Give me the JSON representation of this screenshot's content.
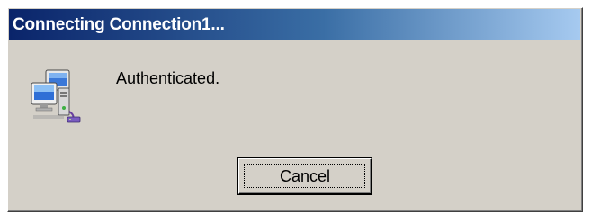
{
  "window": {
    "title": "Connecting Connection1..."
  },
  "status": {
    "message": "Authenticated.",
    "icon": "network-connection-icon"
  },
  "buttons": {
    "cancel_label": "Cancel"
  },
  "colors": {
    "dialog_bg": "#d4d0c8",
    "titlebar_start": "#0a246a",
    "titlebar_end": "#a6caf0",
    "title_text": "#ffffff"
  }
}
